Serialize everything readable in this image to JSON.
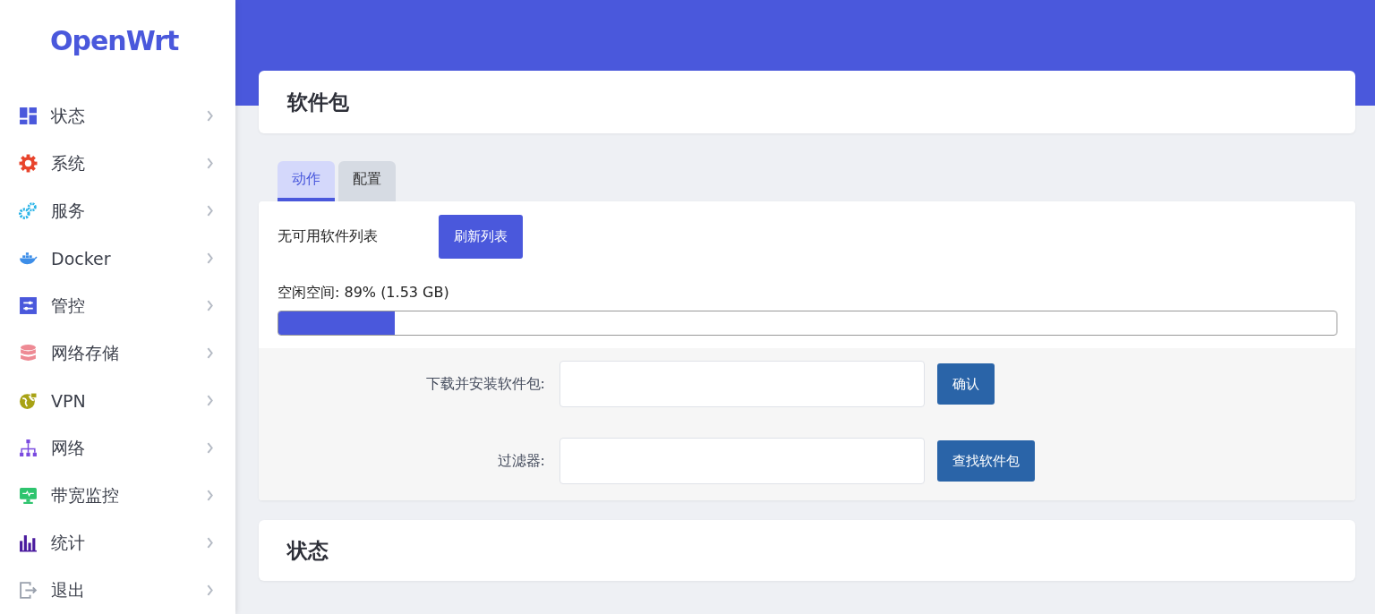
{
  "sidebar": {
    "logo": "OpenWrt",
    "items": [
      {
        "label": "状态"
      },
      {
        "label": "系统"
      },
      {
        "label": "服务"
      },
      {
        "label": "Docker"
      },
      {
        "label": "管控"
      },
      {
        "label": "网络存储"
      },
      {
        "label": "VPN"
      },
      {
        "label": "网络"
      },
      {
        "label": "带宽监控"
      },
      {
        "label": "统计"
      },
      {
        "label": "退出"
      }
    ]
  },
  "page_title": "软件包",
  "tabs": [
    {
      "label": "动作",
      "selected": true
    },
    {
      "label": "配置",
      "selected": false
    }
  ],
  "package_list": {
    "message": "无可用软件列表",
    "button": "刷新列表"
  },
  "free_space": {
    "label": "空闲空间: 89% (1.53 GB)",
    "level": 0.11
  },
  "form": [
    {
      "label": "下载并安装软件包:",
      "button": "确认"
    },
    {
      "label": "过滤器:",
      "button": "查找软件包"
    }
  ],
  "status_title": "状态"
}
